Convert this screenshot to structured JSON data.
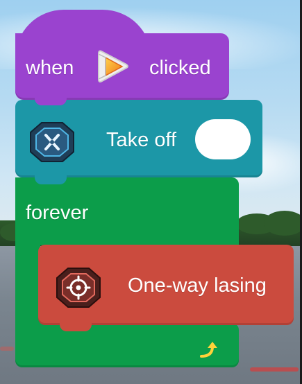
{
  "event_block": {
    "prefix": "when",
    "suffix": "clicked",
    "icon": "play-flag-icon"
  },
  "takeoff_block": {
    "label": "Take off",
    "icon": "drone-cross-icon",
    "toggle_value": ""
  },
  "forever_block": {
    "label": "forever",
    "icon": "loop-arrow-icon"
  },
  "laser_block": {
    "label": "One-way lasing",
    "icon": "crosshair-target-icon"
  },
  "colors": {
    "event": "#9a43cf",
    "takeoff": "#1c97a7",
    "control": "#0c9d4a",
    "laser": "#cb4b3e"
  }
}
